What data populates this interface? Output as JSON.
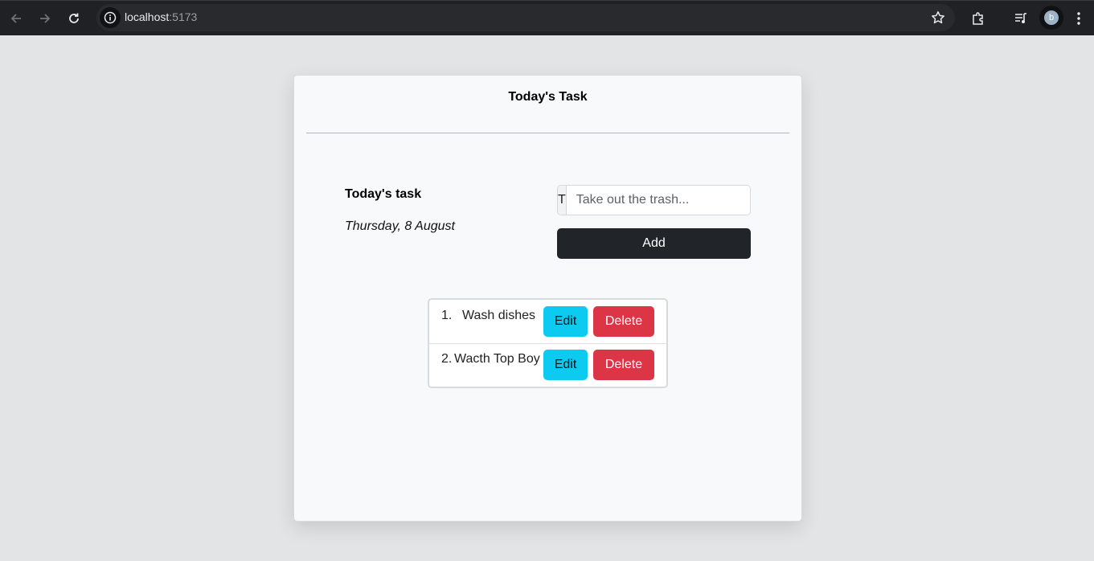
{
  "browser": {
    "url_host": "localhost",
    "url_port": ":5173",
    "profile_initial": "b"
  },
  "card": {
    "title": "Today's Task",
    "section_heading": "Today's task",
    "date": "Thursday, 8 August",
    "input_prefix": "T",
    "input_placeholder": "Take out the trash...",
    "add_label": "Add"
  },
  "tasks": [
    {
      "number": "1.",
      "text": "Wash dishes",
      "edit_label": "Edit",
      "delete_label": "Delete"
    },
    {
      "number": "2.",
      "text": "Wacth Top Boy",
      "edit_label": "Edit",
      "delete_label": "Delete"
    }
  ],
  "colors": {
    "edit": "#0dcaf0",
    "delete": "#dc3545",
    "add": "#212529"
  },
  "icons": [
    "back-arrow-icon",
    "forward-arrow-icon",
    "reload-icon",
    "site-info-icon",
    "bookmark-star-icon",
    "extensions-icon",
    "media-controls-icon",
    "menu-kebab-icon"
  ]
}
